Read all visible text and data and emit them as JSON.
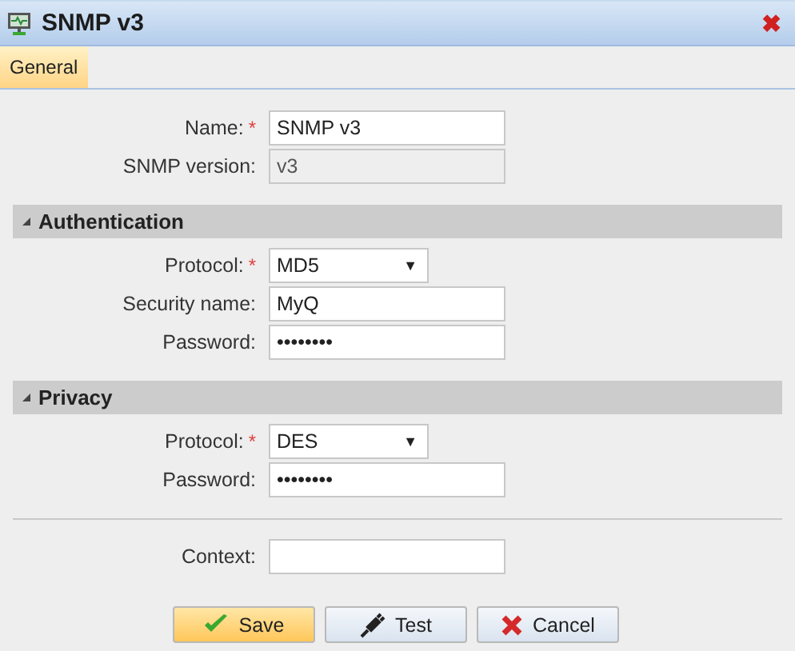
{
  "window": {
    "title": "SNMP v3",
    "close": "✖"
  },
  "tabs": [
    {
      "label": "General",
      "selected": true
    }
  ],
  "top_fields": [
    {
      "kind": "text",
      "label": "Name:",
      "required_mark": "*",
      "value": "SNMP v3",
      "disabled": false
    },
    {
      "kind": "text",
      "label": "SNMP version:",
      "value": "v3",
      "disabled": true
    }
  ],
  "sections": [
    {
      "title": "Authentication",
      "expanded": true,
      "fields": [
        {
          "kind": "select",
          "label": "Protocol:",
          "required_mark": "*",
          "value": "MD5",
          "arrow": "▼"
        },
        {
          "kind": "text",
          "label": "Security name:",
          "value": "MyQ",
          "disabled": false
        },
        {
          "kind": "password",
          "label": "Password:",
          "value": "••••••••",
          "disabled": false
        }
      ]
    },
    {
      "title": "Privacy",
      "expanded": true,
      "fields": [
        {
          "kind": "select",
          "label": "Protocol:",
          "required_mark": "*",
          "value": "DES",
          "arrow": "▼"
        },
        {
          "kind": "password",
          "label": "Password:",
          "value": "••••••••",
          "disabled": false
        }
      ]
    }
  ],
  "bottom_fields": [
    {
      "kind": "text",
      "label": "Context:",
      "disabled": false
    }
  ],
  "buttons": [
    {
      "kind": "save",
      "label": "Save"
    },
    {
      "kind": "test",
      "label": "Test"
    },
    {
      "kind": "cancel",
      "label": "Cancel"
    }
  ]
}
